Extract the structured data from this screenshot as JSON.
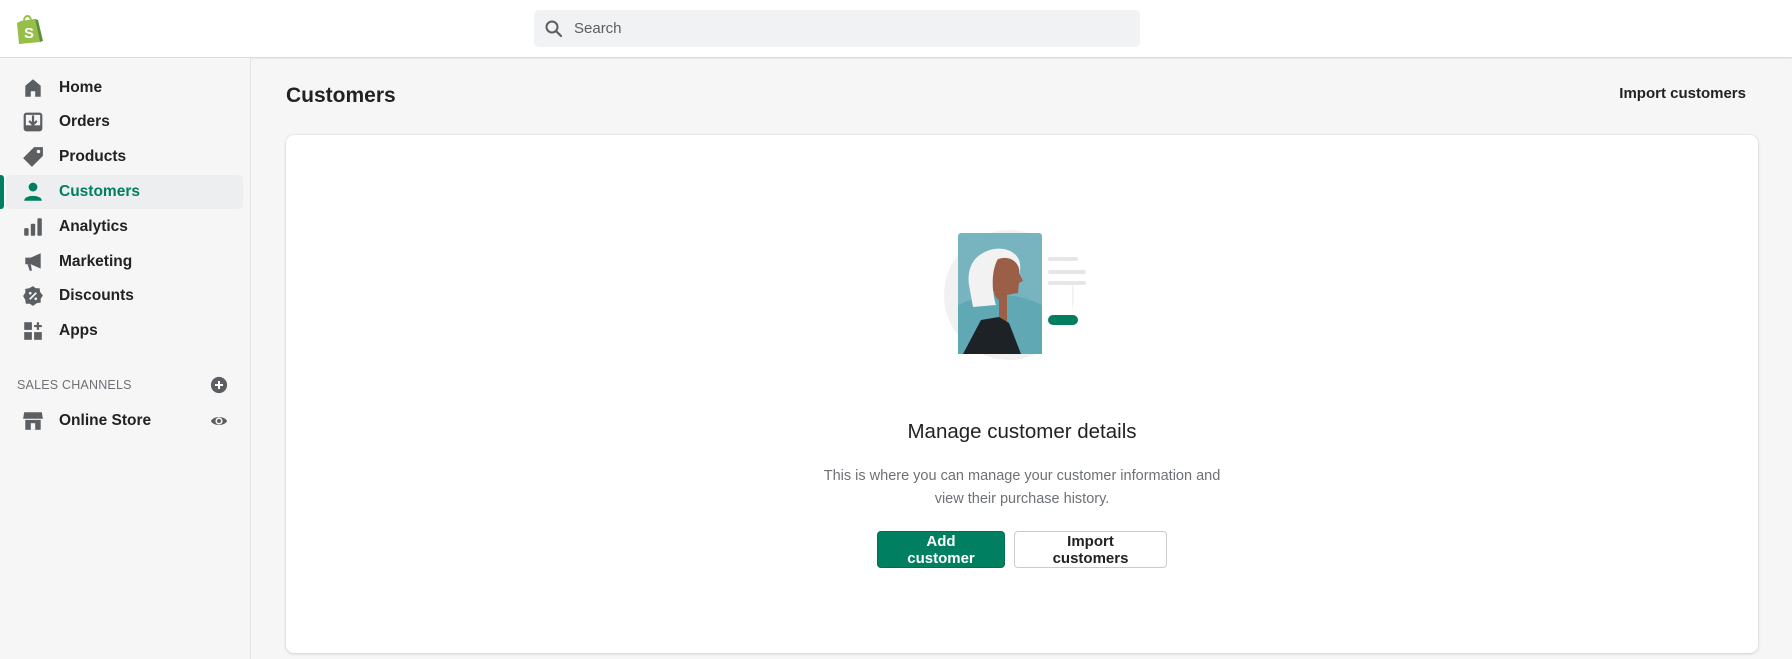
{
  "header": {
    "search_placeholder": "Search"
  },
  "sidebar": {
    "items": [
      {
        "label": "Home",
        "icon": "home-icon"
      },
      {
        "label": "Orders",
        "icon": "orders-icon"
      },
      {
        "label": "Products",
        "icon": "tag-icon"
      },
      {
        "label": "Customers",
        "icon": "person-icon",
        "active": true
      },
      {
        "label": "Analytics",
        "icon": "bar-chart-icon"
      },
      {
        "label": "Marketing",
        "icon": "megaphone-icon"
      },
      {
        "label": "Discounts",
        "icon": "discount-icon"
      },
      {
        "label": "Apps",
        "icon": "apps-icon"
      }
    ],
    "section_title": "SALES CHANNELS",
    "channels": [
      {
        "label": "Online Store",
        "icon": "store-icon"
      }
    ]
  },
  "main": {
    "title": "Customers",
    "import_link": "Import customers",
    "empty_state": {
      "heading": "Manage customer details",
      "description_line1": "This is where you can manage your customer information and",
      "description_line2": "view their purchase history.",
      "primary_button": "Add customer",
      "secondary_button": "Import customers"
    }
  },
  "colors": {
    "accent": "#008060",
    "active_text": "#007f5f",
    "brand": "#95bf47"
  }
}
